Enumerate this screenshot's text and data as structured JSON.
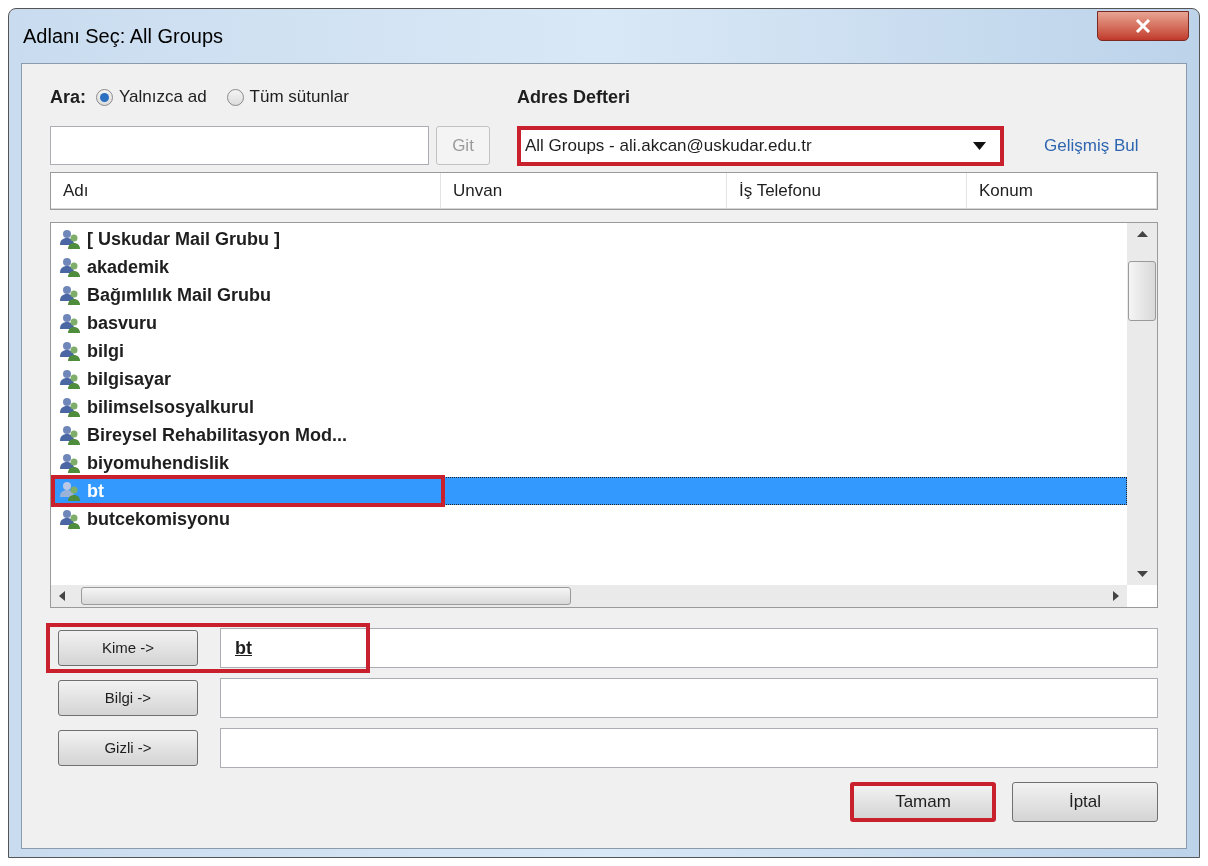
{
  "window": {
    "title": "Adlanı Seç: All Groups"
  },
  "search": {
    "label": "Ara:",
    "options": [
      {
        "label": "Yalnızca ad",
        "selected": true
      },
      {
        "label": "Tüm sütunlar",
        "selected": false
      }
    ],
    "go_button": "Git",
    "go_disabled": true
  },
  "address_book": {
    "label": "Adres Defteri",
    "value": "All Groups - ali.akcan@uskudar.edu.tr",
    "highlighted": true,
    "advanced_link": "Gelişmiş Bul"
  },
  "table": {
    "columns": [
      "Adı",
      "Unvan",
      "İş Telefonu",
      "Konum"
    ],
    "rows": [
      {
        "name": "[ Uskudar Mail Grubu ]",
        "selected": false,
        "highlighted": false
      },
      {
        "name": "akademik",
        "selected": false,
        "highlighted": false
      },
      {
        "name": "Bağımlılık Mail Grubu",
        "selected": false,
        "highlighted": false
      },
      {
        "name": "basvuru",
        "selected": false,
        "highlighted": false
      },
      {
        "name": "bilgi",
        "selected": false,
        "highlighted": false
      },
      {
        "name": "bilgisayar",
        "selected": false,
        "highlighted": false
      },
      {
        "name": "bilimselsosyalkurul",
        "selected": false,
        "highlighted": false
      },
      {
        "name": "Bireysel Rehabilitasyon Mod...",
        "selected": false,
        "highlighted": false
      },
      {
        "name": "biyomuhendislik",
        "selected": false,
        "highlighted": false
      },
      {
        "name": "bt",
        "selected": true,
        "highlighted": true
      },
      {
        "name": "butcekomisyonu",
        "selected": false,
        "highlighted": false
      }
    ]
  },
  "recipients": [
    {
      "button": "Kime ->",
      "value": "bt",
      "highlighted": true
    },
    {
      "button": "Bilgi ->",
      "highlighted": false
    },
    {
      "button": "Gizli ->",
      "highlighted": false
    }
  ],
  "buttons": [
    {
      "label": "Tamam",
      "highlighted": true
    },
    {
      "label": "İptal",
      "highlighted": false
    }
  ]
}
